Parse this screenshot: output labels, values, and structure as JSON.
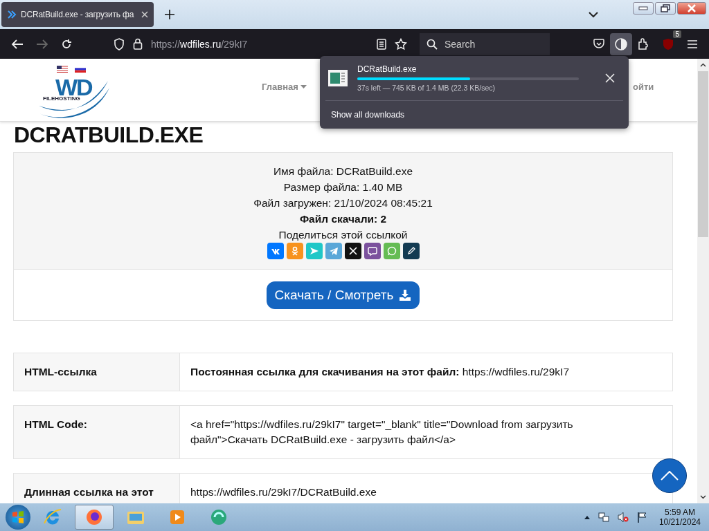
{
  "tabs": [
    {
      "title": "DCRatBuild.exe - загрузить фа",
      "selected": true
    }
  ],
  "toolbar": {
    "url_scheme": "https://",
    "url_host": "wdfiles.ru",
    "url_path": "/29kI7",
    "search_placeholder": "Search",
    "forward_disabled": true,
    "addon_badge": "5"
  },
  "download_panel": {
    "file": "DCRatBuild.exe",
    "level": 0.51,
    "status": "37s left — 745 KB of 1.4 MB (22.3 KB/sec)",
    "show_all": "Show all downloads"
  },
  "site_header": {
    "logo_text": "WD",
    "logo_sub": "FILEHOSTING",
    "nav": [
      {
        "label": "Главная",
        "dropdown": true
      },
      {
        "label": "ойти",
        "dropdown": false
      }
    ]
  },
  "heading": "DCRATBUILD.EXE",
  "file_info": {
    "lines": [
      {
        "label": "Имя файла:",
        "value": "DCRatBuild.exe",
        "bold": false
      },
      {
        "label": "Размер файла:",
        "value": "1.40 MB",
        "bold": false
      },
      {
        "label": "Файл загружен:",
        "value": "21/10/2024 08:45:21",
        "bold": false
      },
      {
        "label": "Файл скачали:",
        "value": "2",
        "bold": true
      }
    ],
    "share_label": "Поделиться этой ссылкой",
    "share": [
      {
        "kind": "vk",
        "color": "#0077ff"
      },
      {
        "kind": "ok",
        "color": "#f7931e"
      },
      {
        "kind": "send",
        "color": "#1fc7c7"
      },
      {
        "kind": "telegram",
        "color": "#5aa7d8"
      },
      {
        "kind": "x",
        "color": "#111111"
      },
      {
        "kind": "viber",
        "color": "#7b519d"
      },
      {
        "kind": "whatsapp",
        "color": "#65bc54"
      },
      {
        "kind": "pen",
        "color": "#133b52"
      }
    ],
    "download_button": "Скачать / Смотреть"
  },
  "links": [
    {
      "label": "HTML-ссылка",
      "text": "**Постоянная ссылка для скачивания на этот файл:** https://wdfiles.ru/29kI7"
    },
    {
      "label": "HTML Code:",
      "text": "<a href=\"https://wdfiles.ru/29kI7\" target=\"_blank\" title=\"Download from загрузить файл\">Скачать DCRatBuild.exe - загрузить файл</a>"
    },
    {
      "label": "Длинная ссылка на этот",
      "text": "https://wdfiles.ru/29kI7/DCRatBuild.exe"
    }
  ],
  "taskbar": {
    "apps": [
      {
        "kind": "ie",
        "selected": false
      },
      {
        "kind": "firefox",
        "selected": true
      },
      {
        "kind": "explorer",
        "selected": false
      },
      {
        "kind": "media",
        "selected": false
      },
      {
        "kind": "app",
        "selected": false
      }
    ],
    "time": "5:59 AM",
    "date": "10/21/2024"
  }
}
